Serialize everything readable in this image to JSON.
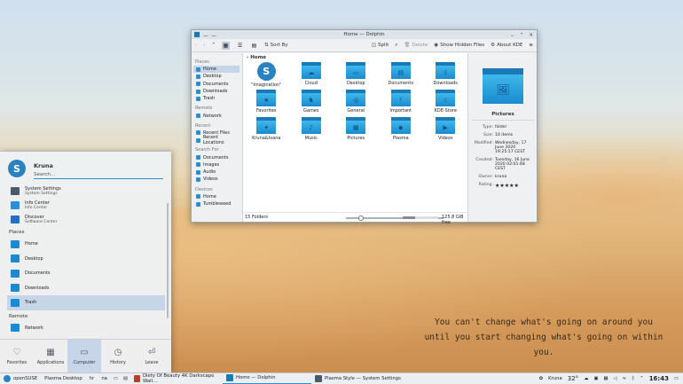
{
  "desktop": {
    "quote_line1": "You can't change what's going on around you",
    "quote_line2": "until you start changing what's going on within you."
  },
  "dolphin": {
    "title": "Home — Dolphin",
    "toolbar": {
      "sort_by": "Sort By",
      "split": "Split",
      "delete": "Delete",
      "show_hidden": "Show Hidden Files",
      "about": "About KDE"
    },
    "places": {
      "places_header": "Places",
      "places_items": [
        "Home",
        "Desktop",
        "Documents",
        "Downloads",
        "Trash"
      ],
      "remote_header": "Remote",
      "remote_items": [
        "Network"
      ],
      "recent_header": "Recent",
      "recent_items": [
        "Recent Files",
        "Recent Locations"
      ],
      "search_header": "Search For",
      "search_items": [
        "Documents",
        "Images",
        "Audio",
        "Videos"
      ],
      "devices_header": "Devices",
      "devices_items": [
        "Home",
        "Tumbleweed"
      ]
    },
    "breadcrumb": "Home",
    "items": [
      "\"Imagination\"",
      "Cloud",
      "Desktop",
      "Documents",
      "Downloads",
      "Favorites",
      "Games",
      "General",
      "Important",
      "KDE-Store",
      "Kruna&Ivana",
      "Music",
      "Pictures",
      "Plasma",
      "Videos"
    ],
    "status": {
      "count": "15 Folders",
      "free": "125.8 GiB free",
      "free_fraction": 0.35
    },
    "info": {
      "name": "Pictures",
      "type_k": "Type:",
      "type_v": "folder",
      "size_k": "Size:",
      "size_v": "10 items",
      "mod_k": "Modified:",
      "mod_v": "Wednesday, 17 June 2020 19:25:17 CEST",
      "created_k": "Created:",
      "created_v": "Tuesday, 16 June 2020 02:01:48 CEST",
      "owner_k": "Owner:",
      "owner_v": "kruna",
      "rating_k": "Rating:",
      "rating_stars": 5
    }
  },
  "menu": {
    "user": "Kruna",
    "search_placeholder": "Search...",
    "apps": [
      {
        "name": "System Settings",
        "desc": "System Settings",
        "color": "#4b5a6a"
      },
      {
        "name": "Info Center",
        "desc": "Info Center",
        "color": "#2a8fd6"
      },
      {
        "name": "Discover",
        "desc": "Software Center",
        "color": "#2471c4"
      }
    ],
    "places_header": "Places",
    "places": [
      "Home",
      "Desktop",
      "Documents",
      "Downloads",
      "Trash"
    ],
    "remote_header": "Remote",
    "remote": [
      "Network"
    ],
    "tabs": [
      "Favorites",
      "Applications",
      "Computer",
      "History",
      "Leave"
    ]
  },
  "taskbar": {
    "start": "openSUSE",
    "desktop": "Plasma Desktop",
    "kb1": "hr",
    "kb2": "na",
    "tasks": [
      "Diety Of Beauty 4K Darkscape Wall...",
      "Home — Dolphin",
      "Plasma Style — System Settings"
    ],
    "user": "Kruna",
    "temp": "32°",
    "time": "16:43"
  },
  "colors": {
    "accent": "#2d8fcf",
    "folder": "#1c79b7",
    "selection": "#c6d6e8"
  }
}
